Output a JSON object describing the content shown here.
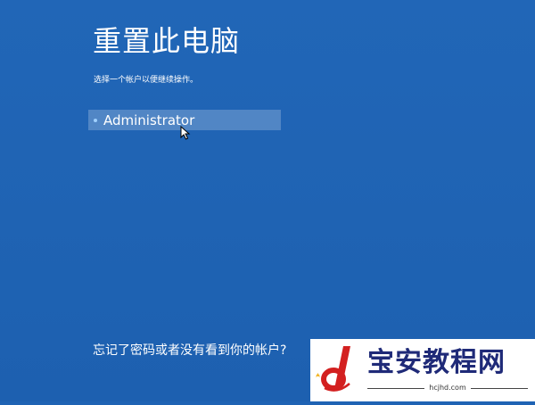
{
  "header": {
    "title": "重置此电脑",
    "subtitle": "选择一个帐户以便继续操作。"
  },
  "accounts": [
    {
      "name": "Administrator"
    }
  ],
  "footer": {
    "forgot_link": "忘记了密码或者没有看到你的帐户?"
  },
  "watermark": {
    "logo_letter": "d",
    "title": "宝安教程网",
    "domain": "hcjhd.com"
  },
  "colors": {
    "background": "#1f63b4",
    "selection": "rgba(255,255,255,0.22)",
    "bullet": "#9fd0ff",
    "watermark_title": "#1f2a78",
    "watermark_logo": "#d32020"
  },
  "icons": {
    "pointer": "mouse-pointer-icon",
    "bullet": "bullet-dot-icon",
    "logo": "site-logo-icon"
  }
}
